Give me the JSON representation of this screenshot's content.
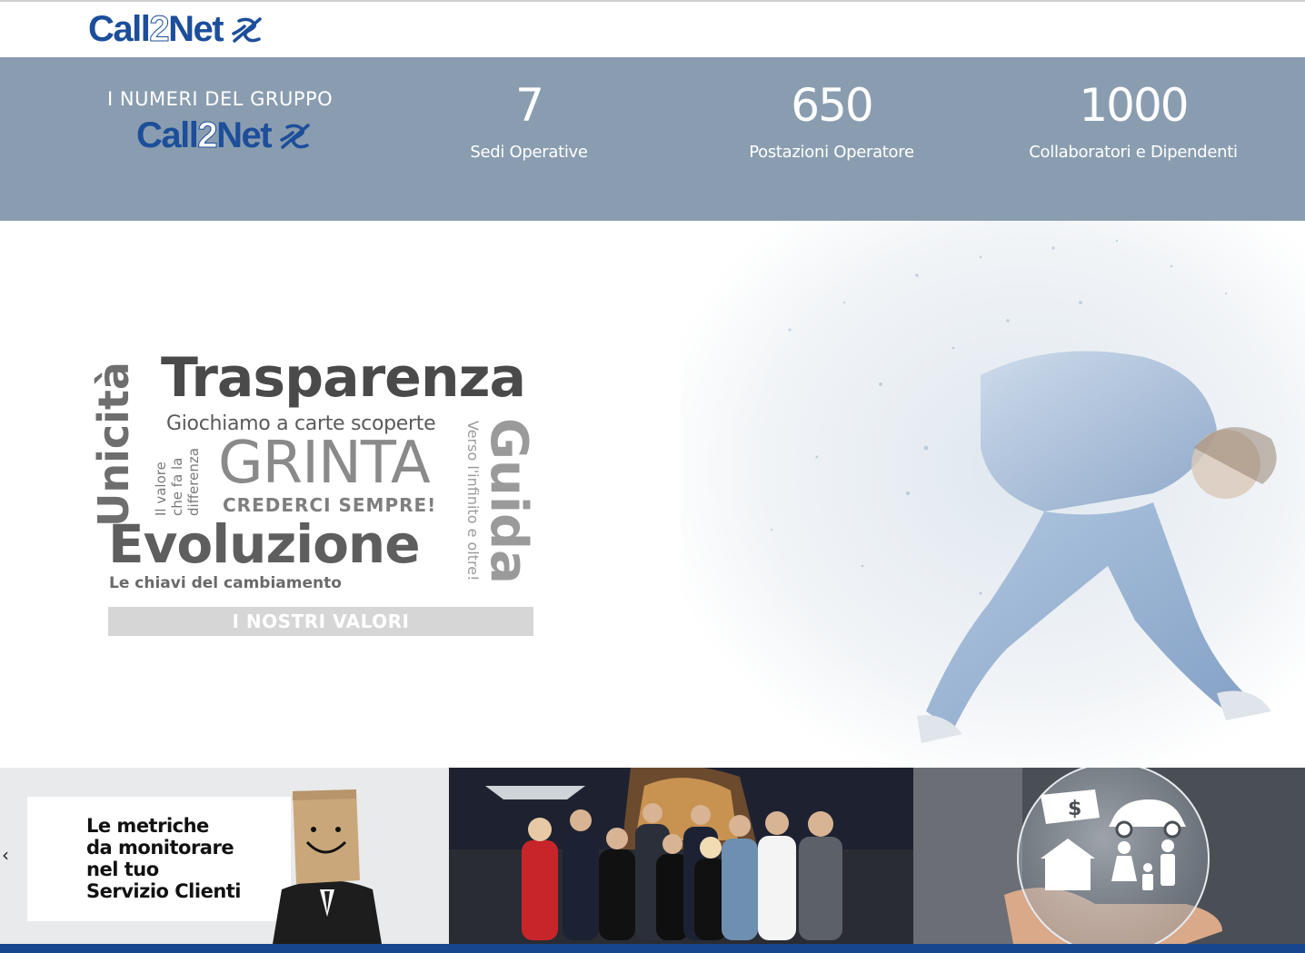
{
  "brand": {
    "name_part1": "Call",
    "name_part2": "2",
    "name_part3": "Net",
    "color": "#1c4e9a"
  },
  "numbers": {
    "title": "I NUMERI DEL GRUPPO",
    "stats": [
      {
        "value": "7",
        "label": "Sedi Operative"
      },
      {
        "value": "650",
        "label": "Postazioni Operatore"
      },
      {
        "value": "1000",
        "label": "Collaboratori e Dipendenti"
      }
    ],
    "background": "#8a9db0"
  },
  "values": {
    "trasparenza": "Trasparenza",
    "unicita": "Unicità",
    "giochiamo": "Giochiamo a carte scoperte",
    "valore": [
      "Il valore",
      "che fa la",
      "differenza"
    ],
    "grinta": "GRINTA",
    "crederci": "CREDERCI SEMPRE!",
    "guida": "Guida",
    "verso": "Verso l'infinito e oltre!",
    "evoluzione": "Evoluzione",
    "chiavi": "Le chiavi del cambiamento",
    "bar": "I NOSTRI VALORI"
  },
  "slider": {
    "prev_icon": "chevron-left-icon",
    "slide1_caption": [
      "Le metriche",
      "da monitorare",
      "nel tuo",
      "Servizio Clienti"
    ]
  },
  "footer_color": "#17468f"
}
